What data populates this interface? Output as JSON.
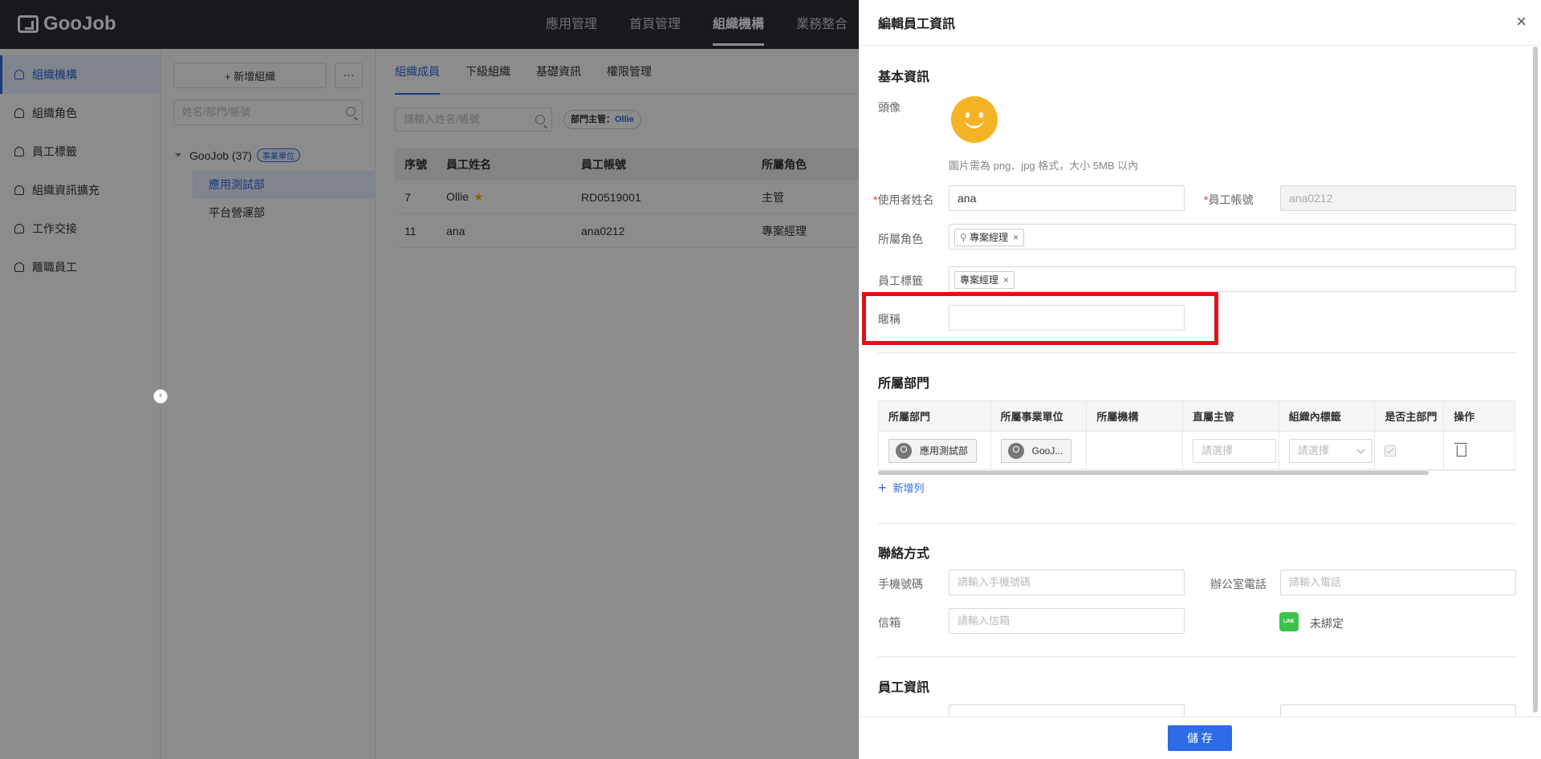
{
  "brand": "GooJob",
  "topnav": [
    "應用管理",
    "首頁管理",
    "組織機構",
    "業務整合"
  ],
  "sidebar": [
    "組織機構",
    "組織角色",
    "員工標籤",
    "組織資訊擴充",
    "工作交接",
    "離職員工"
  ],
  "tree": {
    "add_label": "+ 新增組織",
    "more_label": "···",
    "search_placeholder": "姓名/部門/帳號",
    "root_label": "GooJob (37)",
    "root_badge": "事業單位",
    "children": [
      "應用測試部",
      "平台營運部"
    ]
  },
  "main": {
    "tabs": [
      "組織成員",
      "下級組織",
      "基礎資訊",
      "權限管理"
    ],
    "search_placeholder": "請輸入姓名/帳號",
    "manager_label": "部門主管：",
    "manager_value": "Ollie",
    "columns": [
      "序號",
      "員工姓名",
      "員工帳號",
      "所屬角色"
    ],
    "rows": [
      {
        "no": "7",
        "name": "Ollie",
        "account": "RD0519001",
        "role": "主管"
      },
      {
        "no": "11",
        "name": "ana",
        "account": "ana0212",
        "role": "專案經理"
      }
    ]
  },
  "drawer": {
    "title": "編輯員工資訊",
    "close": "×",
    "basic_section": "基本資訊",
    "avatar_label": "頭像",
    "avatar_hint": "圖片需為 png．jpg 格式，大小 5MB 以內",
    "username_label": "使用者姓名",
    "username_value": "ana",
    "account_label": "員工帳號",
    "account_value": "ana0212",
    "role_label": "所屬角色",
    "role_tag": "專案經理",
    "tag_label": "員工標籤",
    "tag_value": "專案經理",
    "nickname_label": "暱稱",
    "nickname_value": "",
    "dept_section": "所屬部門",
    "dept_columns": [
      "所屬部門",
      "所屬事業單位",
      "所屬機構",
      "直屬主管",
      "組織內標籤",
      "是否主部門",
      "操作"
    ],
    "dept_row": {
      "dept": "應用測試部",
      "unit": "GooJ...",
      "org": "",
      "manager_ph": "請選擇",
      "tag_ph": "請選擇"
    },
    "add_row": "新增列",
    "contact_section": "聯絡方式",
    "mobile_label": "手機號碼",
    "mobile_ph": "請輸入手機號碼",
    "office_label": "辦公室電話",
    "office_ph": "請輸入電話",
    "email_label": "信箱",
    "email_ph": "請輸入信箱",
    "line_icon": "LINE",
    "line_status": "未綁定",
    "employee_section": "員工資訊",
    "save": "儲 存"
  },
  "colors": {
    "primary": "#2e6be6",
    "topbar": "#2b2f38",
    "highlight": "#e0101a"
  }
}
